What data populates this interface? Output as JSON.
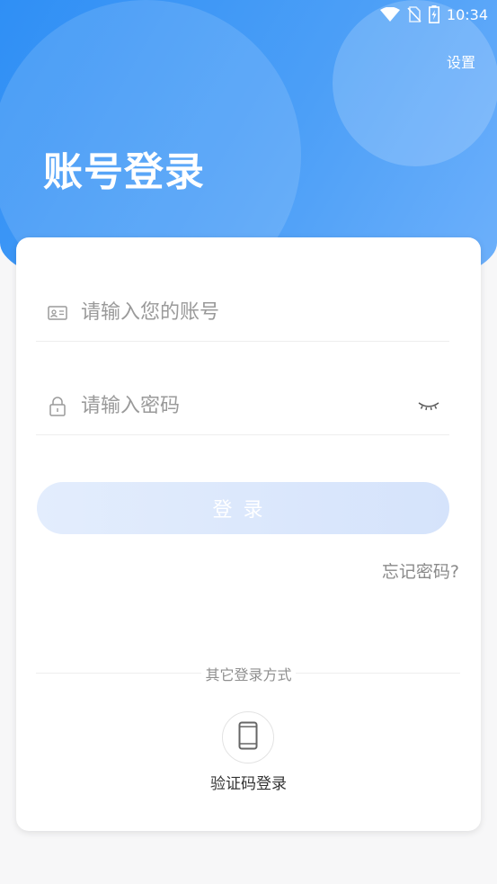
{
  "status_bar": {
    "time": "10:34"
  },
  "header": {
    "settings_label": "设置",
    "title": "账号登录"
  },
  "form": {
    "account": {
      "placeholder": "请输入您的账号",
      "value": ""
    },
    "password": {
      "placeholder": "请输入密码",
      "value": ""
    },
    "login_button": "登录",
    "forgot_password": "忘记密码?"
  },
  "other_login": {
    "label": "其它登录方式",
    "sms_login_label": "验证码登录"
  },
  "colors": {
    "brand_blue": "#2f8ff5",
    "button_bg": "#dbe7fc",
    "text_gray": "#8a8a8a"
  },
  "icons": {
    "account": "id-card-icon",
    "password": "lock-icon",
    "eye": "eye-closed-icon",
    "sms": "phone-icon"
  }
}
